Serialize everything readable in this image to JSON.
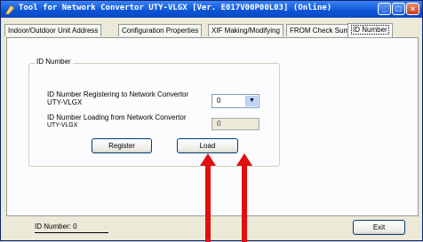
{
  "window": {
    "title": "Tool for Network Convertor UTY-VLGX [Ver. E017V00P00L03] (Online)",
    "accent": "#0b54d6"
  },
  "tabs": [
    {
      "label": "Indoor/Outdoor Unit Address"
    },
    {
      "label": "Configuration Properties"
    },
    {
      "label": "XIF Making/Modifying"
    },
    {
      "label": "FROM Check Sum"
    },
    {
      "label": "ID Number"
    }
  ],
  "id_group": {
    "title": "ID Number",
    "register_label": "ID Number Registering to Network Convertor",
    "register_sub": "UTY-VLGX",
    "register_value": "0",
    "load_label": "ID Number Loading from Network Convertor",
    "load_sub": "UTY-VLGX",
    "load_value": "0",
    "register_button": "Register",
    "load_button": "Load"
  },
  "status": {
    "id_number_text": "ID Number:  0"
  },
  "exit_button": "Exit",
  "annotation_color": "#e01010"
}
